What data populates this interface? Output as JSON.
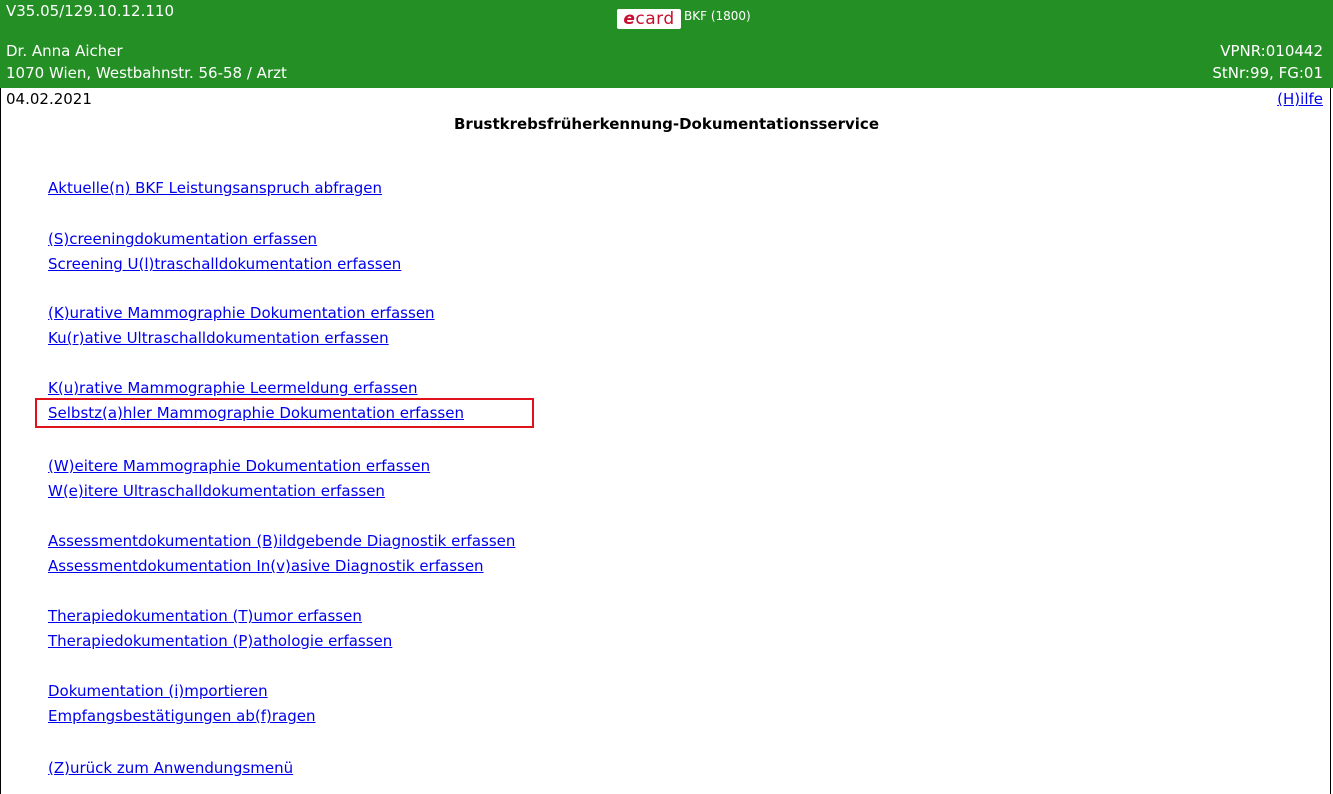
{
  "header": {
    "version": "V35.05/129.10.12.110",
    "doctor_name": "Dr. Anna Aicher",
    "address": "1070 Wien, Westbahnstr. 56-58 / Arzt",
    "vpnr": "VPNR:010442",
    "station": "StNr:99, FG:01",
    "logo_e": "e",
    "logo_card": "card",
    "service_code": "BKF (1800)"
  },
  "date": "04.02.2021",
  "help_link": "(H)ilfe",
  "page_title": "Brustkrebsfrüherkennung-Dokumentationsservice",
  "links": [
    "Aktuelle(n) BKF Leistungsanspruch abfragen",
    "(S)creeningdokumentation erfassen",
    "Screening U(l)traschalldokumentation erfassen",
    "(K)urative Mammographie Dokumentation erfassen",
    "Ku(r)ative Ultraschalldokumentation erfassen",
    "K(u)rative Mammographie Leermeldung erfassen",
    "Selbstz(a)hler Mammographie Dokumentation erfassen",
    "(W)eitere Mammographie Dokumentation erfassen",
    "W(e)itere Ultraschalldokumentation erfassen",
    "Assessmentdokumentation (B)ildgebende Diagnostik erfassen",
    "Assessmentdokumentation In(v)asive Diagnostik erfassen",
    "Therapiedokumentation (T)umor erfassen",
    "Therapiedokumentation (P)athologie erfassen",
    "Dokumentation (i)mportieren",
    "Empfangsbestätigungen ab(f)ragen",
    "(Z)urück zum Anwendungsmenü"
  ],
  "colors": {
    "header_bg": "#248f24",
    "link": "#0000ee",
    "highlight": "#e0131b"
  }
}
